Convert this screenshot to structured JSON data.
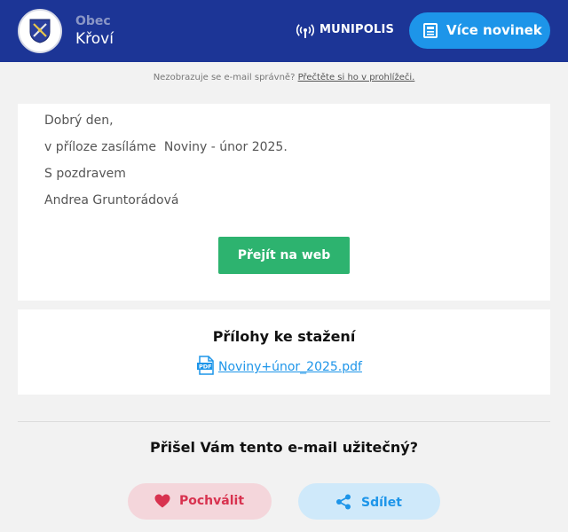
{
  "header": {
    "org_label": "Obec",
    "org_name": "Křoví",
    "brand": "MUNIPOLIS",
    "more_news_label": "Více novinek"
  },
  "notice": {
    "text": "Nezobrazuje se e-mail správně? ",
    "link": "Přečtěte si ho v prohlížeči."
  },
  "message": {
    "greeting": "Dobrý den,",
    "body": "v příloze zasíláme  Noviny - únor 2025.",
    "closing": "S pozdravem",
    "signature": "Andrea Gruntorádová",
    "cta_label": "Přejít na web"
  },
  "attachments": {
    "title": "Přílohy ke stažení",
    "files": [
      {
        "name": "Noviny+únor_2025.pdf",
        "icon": "pdf-file-icon"
      }
    ]
  },
  "feedback": {
    "question": "Přišel Vám tento e-mail užitečný?",
    "praise_label": "Pochválit",
    "share_label": "Sdílet"
  },
  "colors": {
    "header_bg": "#1c3596",
    "accent_blue": "#1d95e9",
    "cta_green": "#2db36f",
    "praise_red": "#d8324f"
  }
}
